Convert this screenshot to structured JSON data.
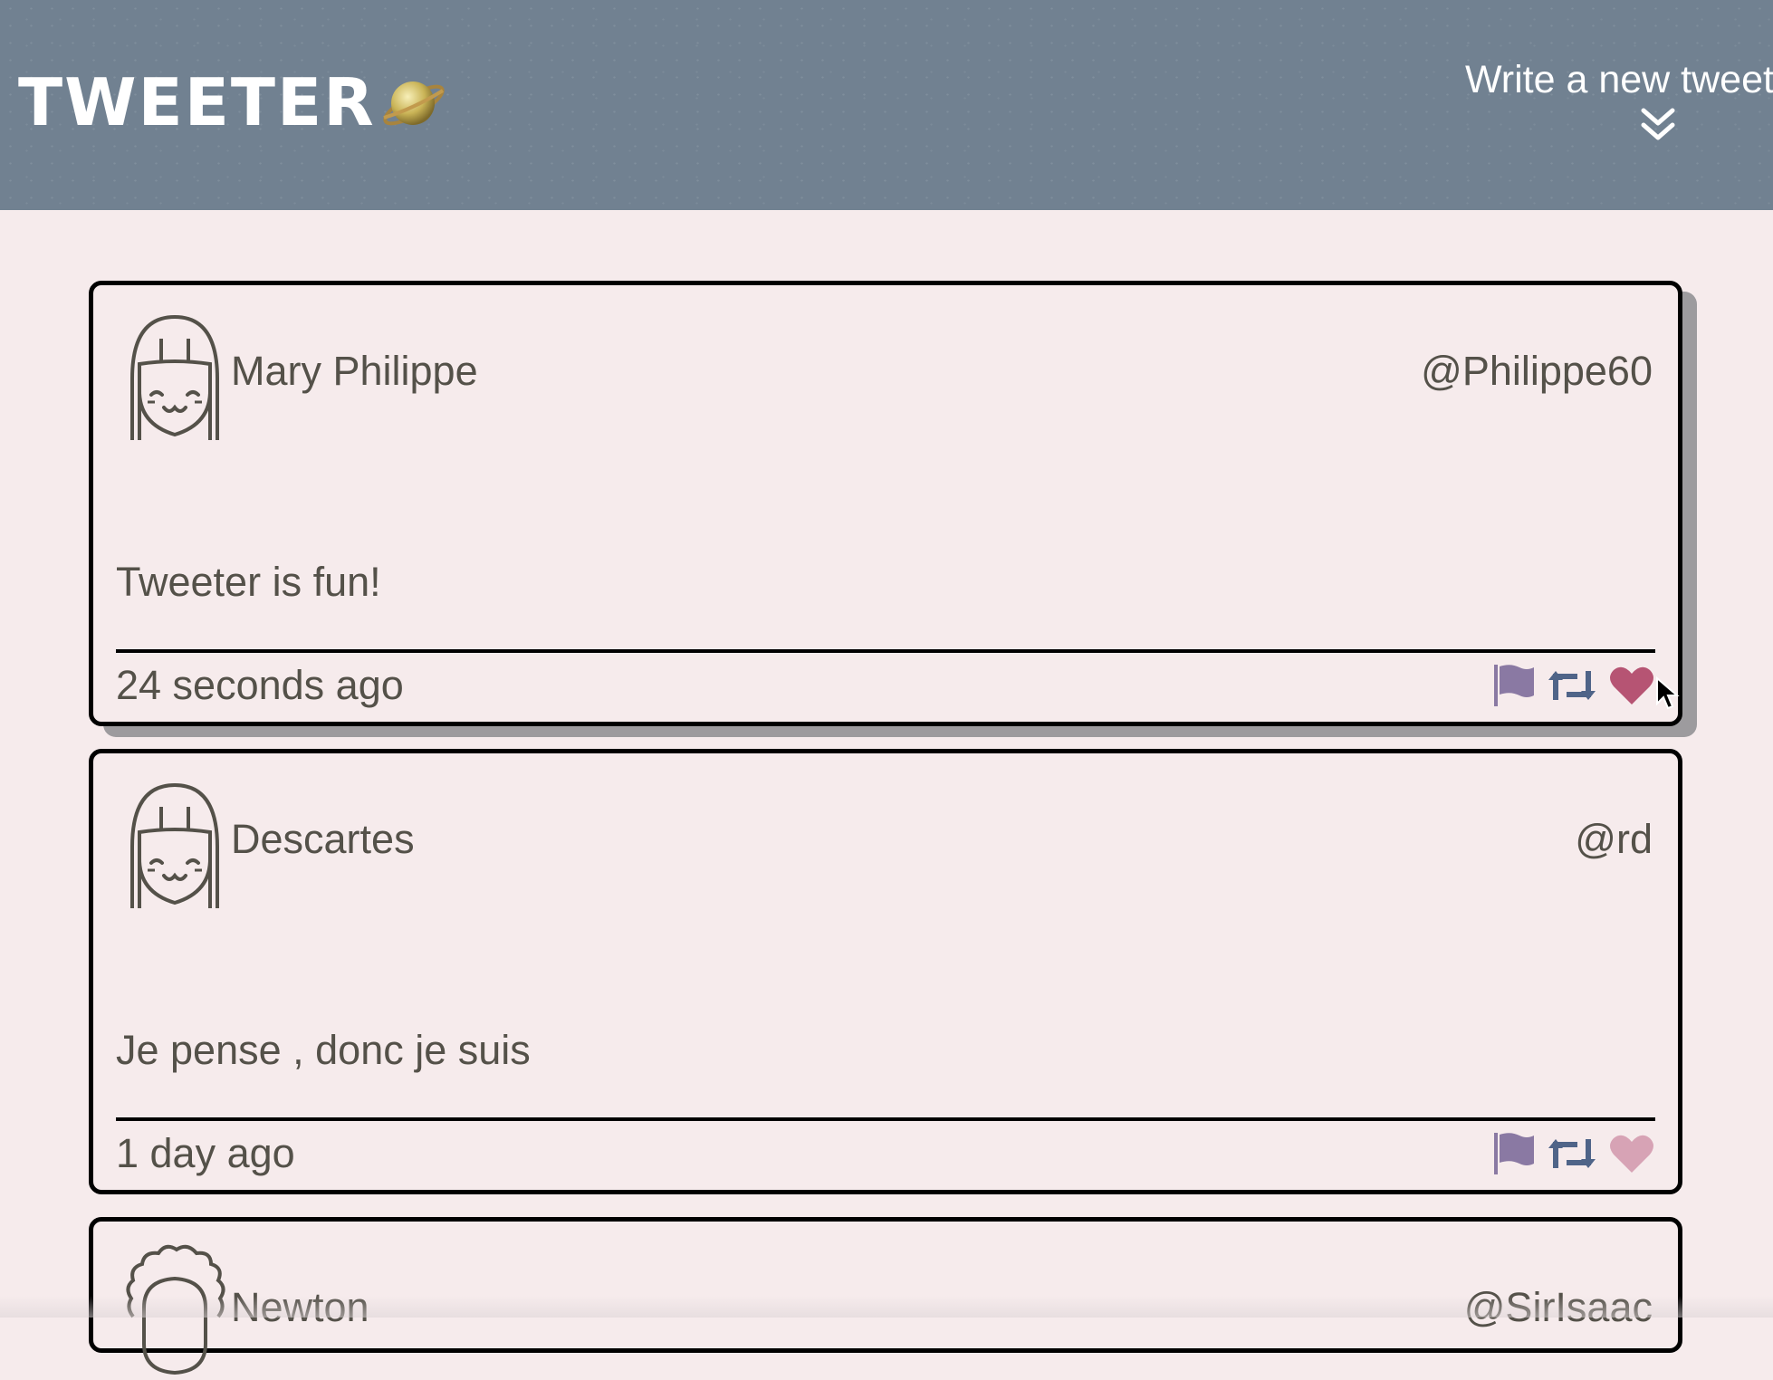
{
  "header": {
    "logo_text": "TWEETER",
    "logo_icon": "planet-icon",
    "compose_label": "Write a new tweet",
    "compose_icon": "double-chevron-down-icon"
  },
  "colors": {
    "header_bg": "#718191",
    "page_bg": "#f6ebec",
    "text": "#545149",
    "flag": "#8a79a3",
    "retweet": "#4f6488",
    "heart_active": "#b65473",
    "heart_inactive": "#d7a3b5"
  },
  "tweets": [
    {
      "name": "Mary Philippe",
      "handle": "@Philippe60",
      "text": "Tweeter is fun!",
      "time": "24 seconds ago",
      "avatar": "girl-face-avatar",
      "liked": true
    },
    {
      "name": "Descartes",
      "handle": "@rd",
      "text": "Je pense , donc je suis",
      "time": "1 day ago",
      "avatar": "girl-face-avatar",
      "liked": false
    },
    {
      "name": "Newton",
      "handle": "@SirIsaac",
      "avatar": "curly-hair-avatar"
    }
  ]
}
